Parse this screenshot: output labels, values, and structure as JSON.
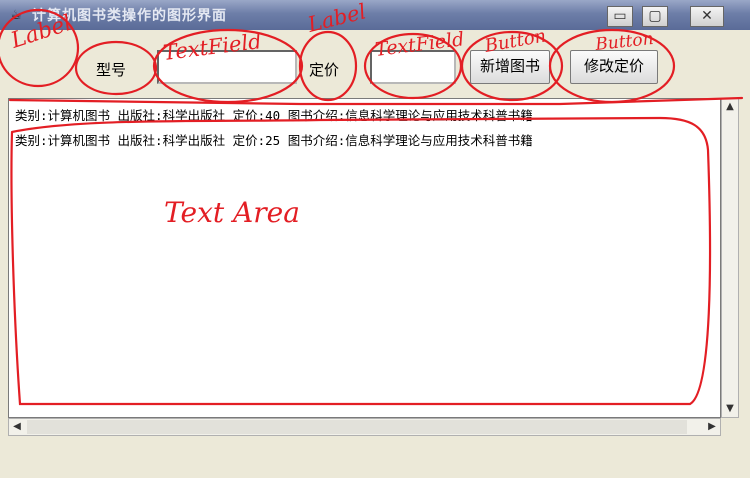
{
  "window": {
    "title": "计算机图书类操作的图形界面",
    "app_icon": "java-cup-icon",
    "controls": {
      "minimize": "▭",
      "maximize": "▢",
      "close": "✕"
    }
  },
  "toolbar": {
    "model_label": "型号",
    "model_value": "",
    "price_label": "定价",
    "price_value": "",
    "add_button": "新增图书",
    "edit_button": "修改定价"
  },
  "textarea": {
    "lines": [
      "类别:计算机图书 出版社:科学出版社 定价:40 图书介绍:信息科学理论与应用技术科普书籍",
      "类别:计算机图书 出版社:科学出版社 定价:25 图书介绍:信息科学理论与应用技术科普书籍"
    ]
  },
  "scrollbars": {
    "up": "▲",
    "down": "▼",
    "left": "◀",
    "right": "▶"
  },
  "annotations": {
    "label_1": "Label",
    "textfield_1": "TextField",
    "label_2": "Label",
    "textfield_2": "TextField",
    "button_1": "Button",
    "button_2": "Button",
    "textarea": "Text Area",
    "color": "#e31e24"
  }
}
